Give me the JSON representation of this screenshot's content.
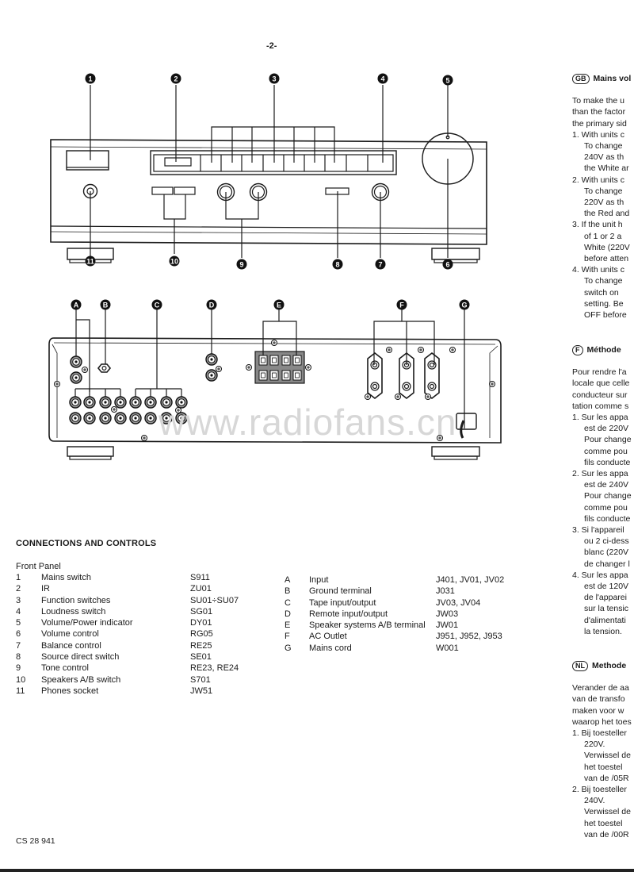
{
  "page": {
    "page_number": "-2-",
    "watermark": "www.radiofans.cn",
    "footer_code": "CS 28 941"
  },
  "front_panel_callouts": [
    "1",
    "2",
    "3",
    "4",
    "5",
    "6",
    "7",
    "8",
    "9",
    "10",
    "11"
  ],
  "rear_panel_callouts": [
    "A",
    "B",
    "C",
    "D",
    "E",
    "F",
    "G"
  ],
  "connections": {
    "title": "CONNECTIONS AND CONTROLS",
    "front_panel_heading": "Front Panel",
    "front_items": [
      {
        "num": "1",
        "label": "Mains switch",
        "code": "S911"
      },
      {
        "num": "2",
        "label": "IR",
        "code": "ZU01"
      },
      {
        "num": "3",
        "label": "Function switches",
        "code": "SU01÷SU07"
      },
      {
        "num": "4",
        "label": "Loudness switch",
        "code": "SG01"
      },
      {
        "num": "5",
        "label": "Volume/Power indicator",
        "code": "DY01"
      },
      {
        "num": "6",
        "label": "Volume control",
        "code": "RG05"
      },
      {
        "num": "7",
        "label": "Balance control",
        "code": "RE25"
      },
      {
        "num": "8",
        "label": "Source direct switch",
        "code": "SE01"
      },
      {
        "num": "9",
        "label": "Tone control",
        "code": "RE23, RE24"
      },
      {
        "num": "10",
        "label": "Speakers A/B switch",
        "code": "S701"
      },
      {
        "num": "11",
        "label": "Phones socket",
        "code": "JW51"
      }
    ],
    "rear_items": [
      {
        "num": "A",
        "label": "Input",
        "code": "J401, JV01, JV02"
      },
      {
        "num": "B",
        "label": "Ground terminal",
        "code": "J031"
      },
      {
        "num": "C",
        "label": "Tape input/output",
        "code": "JV03, JV04"
      },
      {
        "num": "D",
        "label": "Remote input/output",
        "code": "JW03"
      },
      {
        "num": "E",
        "label": "Speaker systems A/B terminal",
        "code": "JW01"
      },
      {
        "num": "F",
        "label": "AC Outlet",
        "code": "J951, J952, J953"
      },
      {
        "num": "G",
        "label": "Mains cord",
        "code": "W001"
      }
    ]
  },
  "right_column": {
    "gb": {
      "badge": "GB",
      "heading": "Mains vol",
      "intro": [
        "To make the u",
        "than the factor",
        "the primary sid"
      ],
      "items": [
        {
          "n": "1.",
          "lines": [
            "With units c",
            "To change",
            "240V as th",
            "the White ar"
          ]
        },
        {
          "n": "2.",
          "lines": [
            "With units c",
            "To change",
            "220V as th",
            "the Red and"
          ]
        },
        {
          "n": "3.",
          "lines": [
            "If the unit h",
            "of 1 or 2 a",
            "White (220V",
            "before atten"
          ]
        },
        {
          "n": "4.",
          "lines": [
            "With units c",
            "To change",
            "switch on",
            "setting. Be",
            "OFF before"
          ]
        }
      ]
    },
    "f": {
      "badge": "F",
      "heading": "Méthode",
      "intro": [
        "Pour rendre l'a",
        "locale que celle",
        "conducteur sur",
        "tation comme s"
      ],
      "items": [
        {
          "n": "1.",
          "lines": [
            "Sur les appa",
            "est de 220V",
            "Pour change",
            "comme pou",
            "fils conducte"
          ]
        },
        {
          "n": "2.",
          "lines": [
            "Sur les appa",
            "est de 240V",
            "Pour change",
            "comme pou",
            "fils conducte"
          ]
        },
        {
          "n": "3.",
          "lines": [
            "Si l'appareil",
            "ou 2 ci-dess",
            "blanc (220V",
            "de changer l"
          ]
        },
        {
          "n": "4.",
          "lines": [
            "Sur les appa",
            "est de 120V",
            "de l'apparei",
            "sur la tensic",
            "d'alimentati",
            "la tension."
          ]
        }
      ]
    },
    "nl": {
      "badge": "NL",
      "heading": "Methode",
      "intro": [
        "Verander de aa",
        "van de transfo",
        "maken voor w",
        "waarop het toes"
      ],
      "items": [
        {
          "n": "1.",
          "lines": [
            "Bij toesteller",
            "220V.",
            "Verwissel de",
            "het toestel",
            "van de /05R"
          ]
        },
        {
          "n": "2.",
          "lines": [
            "Bij toesteller",
            "240V.",
            "Verwissel de",
            "het toestel",
            "van de /00R"
          ]
        }
      ]
    }
  }
}
